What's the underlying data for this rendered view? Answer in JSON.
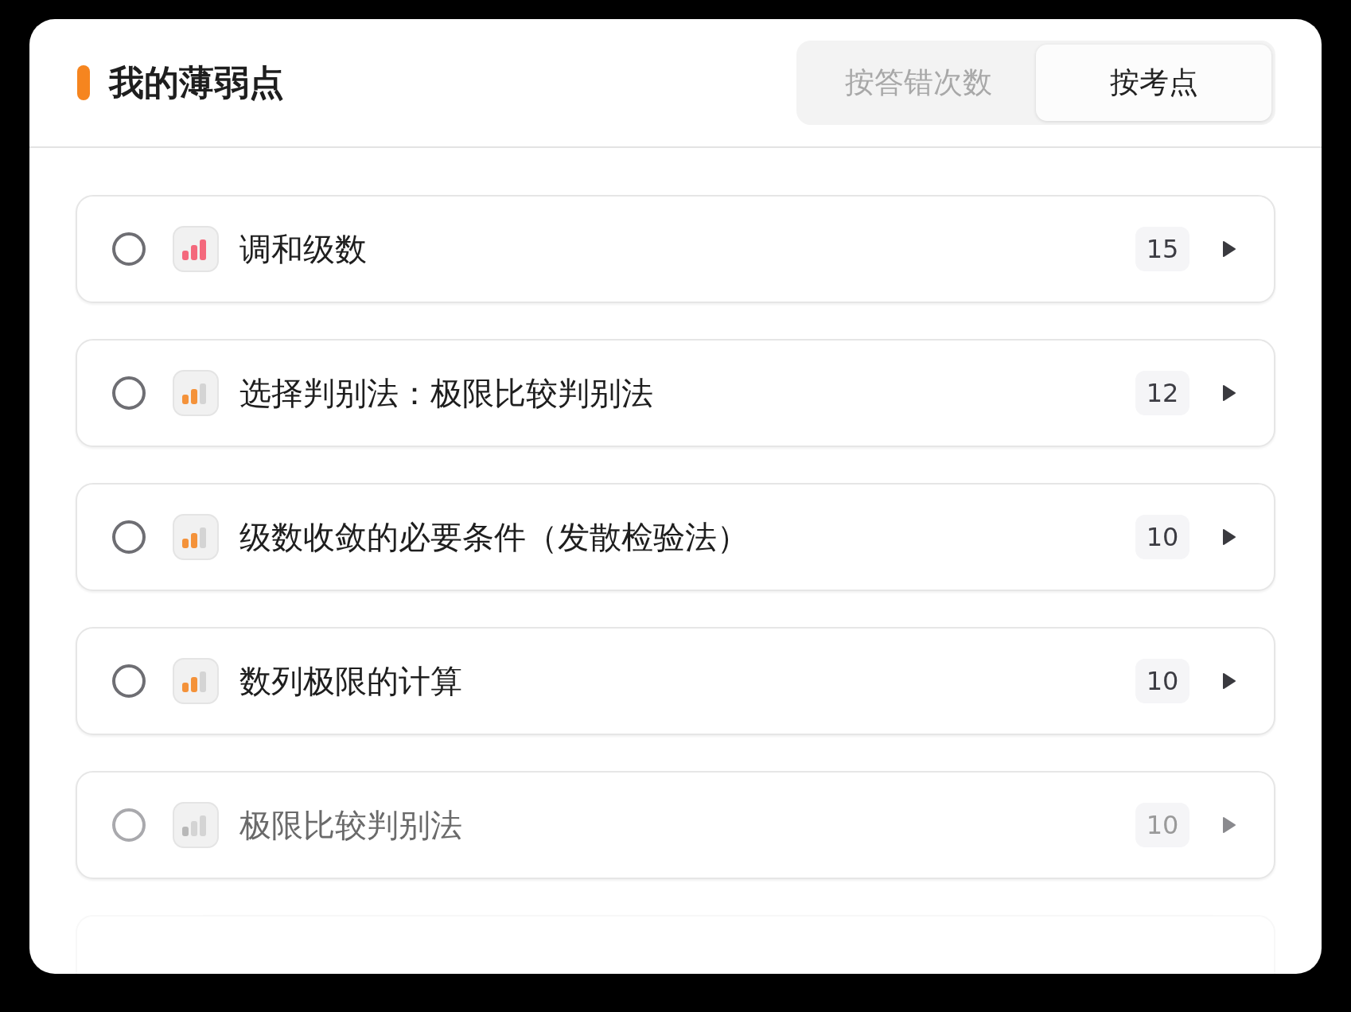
{
  "header": {
    "title": "我的薄弱点"
  },
  "sort_tabs": [
    {
      "label": "按答错次数",
      "selected": false
    },
    {
      "label": "按考点",
      "selected": true
    }
  ],
  "items": [
    {
      "name": "调和级数",
      "count": "15",
      "kind": "high",
      "color": "#f4687c",
      "checked": false,
      "faded": false
    },
    {
      "name": "选择判别法：极限比较判别法",
      "count": "12",
      "kind": "medium",
      "color": "#f4923a",
      "checked": false,
      "faded": false
    },
    {
      "name": "级数收敛的必要条件（发散检验法）",
      "count": "10",
      "kind": "medium",
      "color": "#f4923a",
      "checked": false,
      "faded": false
    },
    {
      "name": "数列极限的计算",
      "count": "10",
      "kind": "medium",
      "color": "#f4923a",
      "checked": false,
      "faded": false
    },
    {
      "name": "极限比较判别法",
      "count": "10",
      "kind": "low",
      "color": "#b8b8b8",
      "checked": false,
      "faded": true
    }
  ],
  "more_below": true
}
